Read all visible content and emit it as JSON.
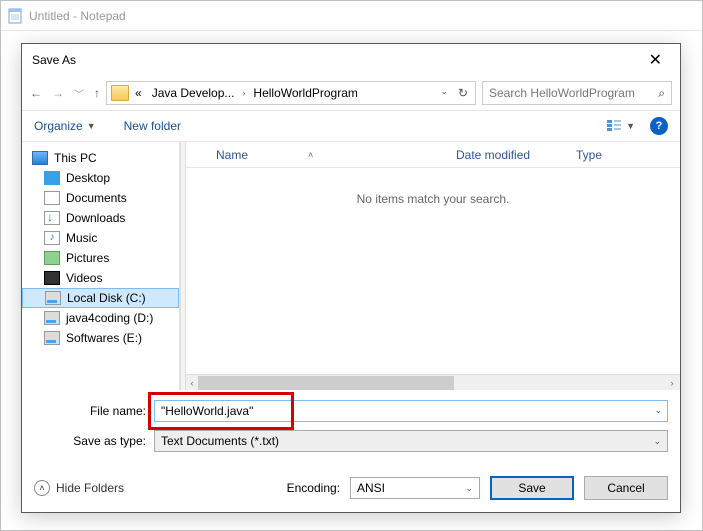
{
  "notepad": {
    "title": "Untitled - Notepad"
  },
  "dialog": {
    "title": "Save As",
    "breadcrumb": {
      "prefix": "«",
      "part1": "Java Develop...",
      "part2": "HelloWorldProgram"
    },
    "search_placeholder": "Search HelloWorldProgram",
    "toolbar": {
      "organize": "Organize",
      "new_folder": "New folder"
    },
    "tree": {
      "this_pc": "This PC",
      "items": [
        {
          "label": "Desktop"
        },
        {
          "label": "Documents"
        },
        {
          "label": "Downloads"
        },
        {
          "label": "Music"
        },
        {
          "label": "Pictures"
        },
        {
          "label": "Videos"
        },
        {
          "label": "Local Disk (C:)"
        },
        {
          "label": "java4coding (D:)"
        },
        {
          "label": "Softwares (E:)"
        }
      ]
    },
    "columns": {
      "name": "Name",
      "date": "Date modified",
      "type": "Type"
    },
    "empty_message": "No items match your search.",
    "filename_label": "File name:",
    "filename_value": "\"HelloWorld.java\"",
    "savetype_label": "Save as type:",
    "savetype_value": "Text Documents (*.txt)",
    "hide_folders": "Hide Folders",
    "encoding_label": "Encoding:",
    "encoding_value": "ANSI",
    "save_btn": "Save",
    "cancel_btn": "Cancel"
  }
}
